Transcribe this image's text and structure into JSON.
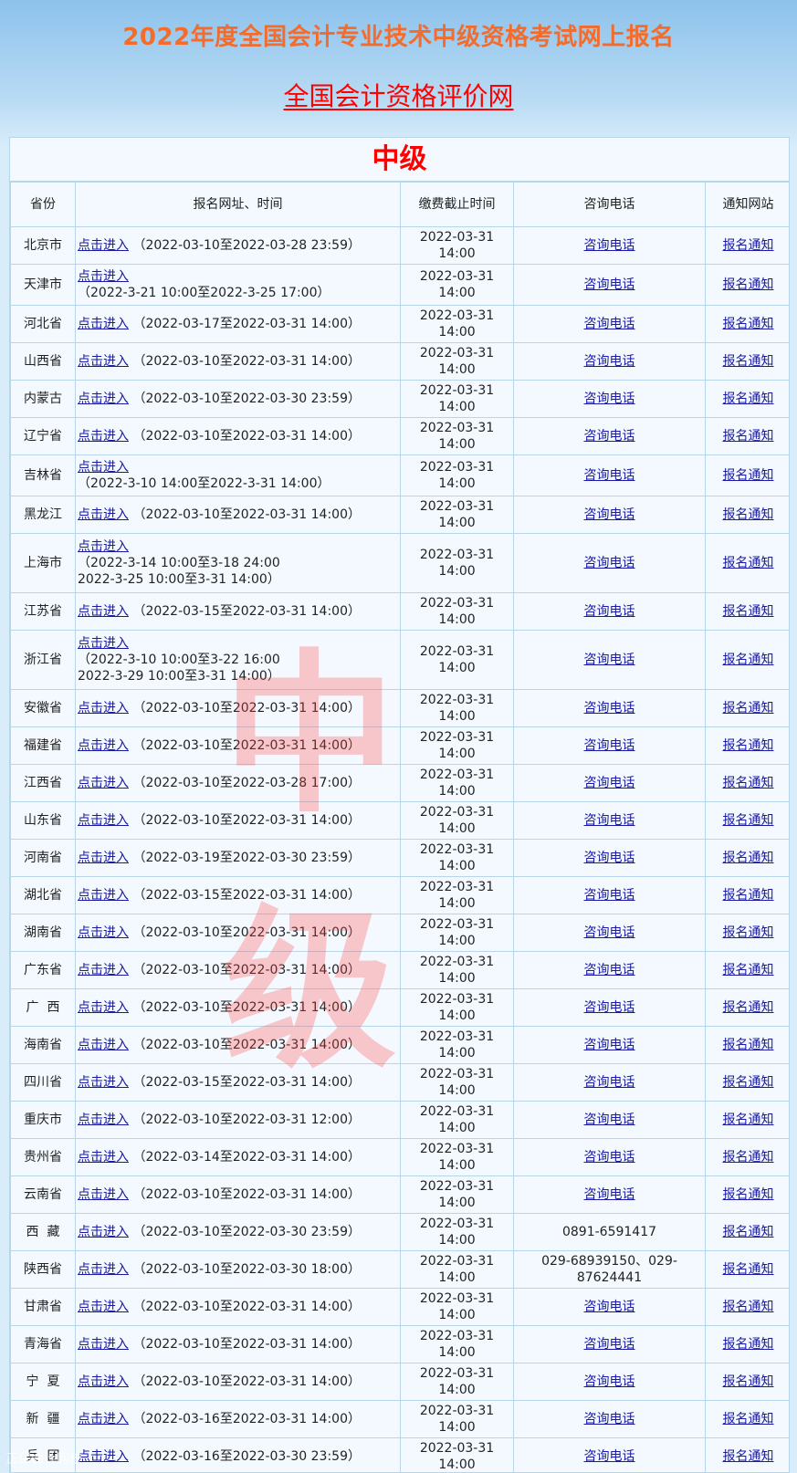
{
  "header": {
    "title": "2022年度全国会计专业技术中级资格考试网上报名",
    "site_link": "全国会计资格评价网"
  },
  "panel": {
    "title": "中级"
  },
  "watermark": {
    "char1": "中",
    "char2": "级"
  },
  "corner_watermark": "正保会计网校",
  "table": {
    "headers": [
      "省份",
      "报名网址、时间",
      "缴费截止时间",
      "咨询电话",
      "通知网站"
    ],
    "link_text": "点击进入",
    "phone_link_text": "咨询电话",
    "notice_link_text": "报名通知",
    "rows": [
      {
        "province": "北京市",
        "range1": "（2022-03-10至2022-03-28 23:59）",
        "range2": "",
        "deadline": "2022-03-31 14:00",
        "phone": "咨询电话",
        "layout": "inline"
      },
      {
        "province": "天津市",
        "range1": "（2022-3-21 10:00至2022-3-25 17:00）",
        "range2": "",
        "deadline": "2022-03-31 14:00",
        "phone": "咨询电话",
        "layout": "stacked"
      },
      {
        "province": "河北省",
        "range1": "（2022-03-17至2022-03-31 14:00）",
        "range2": "",
        "deadline": "2022-03-31 14:00",
        "phone": "咨询电话",
        "layout": "inline"
      },
      {
        "province": "山西省",
        "range1": "（2022-03-10至2022-03-31 14:00）",
        "range2": "",
        "deadline": "2022-03-31 14:00",
        "phone": "咨询电话",
        "layout": "inline"
      },
      {
        "province": "内蒙古",
        "range1": "（2022-03-10至2022-03-30 23:59）",
        "range2": "",
        "deadline": "2022-03-31 14:00",
        "phone": "咨询电话",
        "layout": "inline"
      },
      {
        "province": "辽宁省",
        "range1": "（2022-03-10至2022-03-31 14:00）",
        "range2": "",
        "deadline": "2022-03-31 14:00",
        "phone": "咨询电话",
        "layout": "inline"
      },
      {
        "province": "吉林省",
        "range1": "（2022-3-10 14:00至2022-3-31 14:00）",
        "range2": "",
        "deadline": "2022-03-31 14:00",
        "phone": "咨询电话",
        "layout": "stacked"
      },
      {
        "province": "黑龙江",
        "range1": "（2022-03-10至2022-03-31 14:00）",
        "range2": "",
        "deadline": "2022-03-31 14:00",
        "phone": "咨询电话",
        "layout": "inline"
      },
      {
        "province": "上海市",
        "range1": "（2022-3-14 10:00至3-18 24:00",
        "range2": "2022-3-25 10:00至3-31 14:00）",
        "deadline": "2022-03-31 14:00",
        "phone": "咨询电话",
        "layout": "stacked3"
      },
      {
        "province": "江苏省",
        "range1": "（2022-03-15至2022-03-31 14:00）",
        "range2": "",
        "deadline": "2022-03-31 14:00",
        "phone": "咨询电话",
        "layout": "inline"
      },
      {
        "province": "浙江省",
        "range1": "（2022-3-10 10:00至3-22 16:00",
        "range2": "2022-3-29 10:00至3-31 14:00）",
        "deadline": "2022-03-31 14:00",
        "phone": "咨询电话",
        "layout": "stacked3"
      },
      {
        "province": "安徽省",
        "range1": "（2022-03-10至2022-03-31 14:00）",
        "range2": "",
        "deadline": "2022-03-31 14:00",
        "phone": "咨询电话",
        "layout": "inline"
      },
      {
        "province": "福建省",
        "range1": "（2022-03-10至2022-03-31 14:00）",
        "range2": "",
        "deadline": "2022-03-31 14:00",
        "phone": "咨询电话",
        "layout": "inline"
      },
      {
        "province": "江西省",
        "range1": "（2022-03-10至2022-03-28 17:00）",
        "range2": "",
        "deadline": "2022-03-31 14:00",
        "phone": "咨询电话",
        "layout": "inline"
      },
      {
        "province": "山东省",
        "range1": "（2022-03-10至2022-03-31 14:00）",
        "range2": "",
        "deadline": "2022-03-31 14:00",
        "phone": "咨询电话",
        "layout": "inline"
      },
      {
        "province": "河南省",
        "range1": "（2022-03-19至2022-03-30 23:59）",
        "range2": "",
        "deadline": "2022-03-31 14:00",
        "phone": "咨询电话",
        "layout": "inline"
      },
      {
        "province": "湖北省",
        "range1": "（2022-03-15至2022-03-31 14:00）",
        "range2": "",
        "deadline": "2022-03-31 14:00",
        "phone": "咨询电话",
        "layout": "inline"
      },
      {
        "province": "湖南省",
        "range1": "（2022-03-10至2022-03-31 14:00）",
        "range2": "",
        "deadline": "2022-03-31 14:00",
        "phone": "咨询电话",
        "layout": "inline"
      },
      {
        "province": "广东省",
        "range1": "（2022-03-10至2022-03-31 14:00）",
        "range2": "",
        "deadline": "2022-03-31 14:00",
        "phone": "咨询电话",
        "layout": "inline"
      },
      {
        "province": "广  西",
        "range1": "（2022-03-10至2022-03-31 14:00）",
        "range2": "",
        "deadline": "2022-03-31 14:00",
        "phone": "咨询电话",
        "layout": "inline"
      },
      {
        "province": "海南省",
        "range1": "（2022-03-10至2022-03-31 14:00）",
        "range2": "",
        "deadline": "2022-03-31 14:00",
        "phone": "咨询电话",
        "layout": "inline"
      },
      {
        "province": "四川省",
        "range1": "（2022-03-15至2022-03-31 14:00）",
        "range2": "",
        "deadline": "2022-03-31 14:00",
        "phone": "咨询电话",
        "layout": "inline"
      },
      {
        "province": "重庆市",
        "range1": "（2022-03-10至2022-03-31 12:00）",
        "range2": "",
        "deadline": "2022-03-31 14:00",
        "phone": "咨询电话",
        "layout": "inline"
      },
      {
        "province": "贵州省",
        "range1": "（2022-03-14至2022-03-31 14:00）",
        "range2": "",
        "deadline": "2022-03-31 14:00",
        "phone": "咨询电话",
        "layout": "inline"
      },
      {
        "province": "云南省",
        "range1": "（2022-03-10至2022-03-31 14:00）",
        "range2": "",
        "deadline": "2022-03-31 14:00",
        "phone": "咨询电话",
        "layout": "inline"
      },
      {
        "province": "西  藏",
        "range1": "（2022-03-10至2022-03-30 23:59）",
        "range2": "",
        "deadline": "2022-03-31 14:00",
        "phone": "0891-6591417",
        "phone_plain": true,
        "layout": "inline"
      },
      {
        "province": "陕西省",
        "range1": "（2022-03-10至2022-03-30 18:00）",
        "range2": "",
        "deadline": "2022-03-31 14:00",
        "phone": "029-68939150、029-87624441",
        "phone_plain": true,
        "layout": "inline"
      },
      {
        "province": "甘肃省",
        "range1": "（2022-03-10至2022-03-31 14:00）",
        "range2": "",
        "deadline": "2022-03-31 14:00",
        "phone": "咨询电话",
        "layout": "inline"
      },
      {
        "province": "青海省",
        "range1": "（2022-03-10至2022-03-31 14:00）",
        "range2": "",
        "deadline": "2022-03-31 14:00",
        "phone": "咨询电话",
        "layout": "inline"
      },
      {
        "province": "宁  夏",
        "range1": "（2022-03-10至2022-03-31 14:00）",
        "range2": "",
        "deadline": "2022-03-31 14:00",
        "phone": "咨询电话",
        "layout": "inline"
      },
      {
        "province": "新  疆",
        "range1": "（2022-03-16至2022-03-31 14:00）",
        "range2": "",
        "deadline": "2022-03-31 14:00",
        "phone": "咨询电话",
        "layout": "inline"
      },
      {
        "province": "兵  团",
        "range1": "（2022-03-16至2022-03-30 23:59）",
        "range2": "",
        "deadline": "2022-03-31 14:00",
        "phone": "咨询电话",
        "layout": "inline"
      }
    ]
  }
}
